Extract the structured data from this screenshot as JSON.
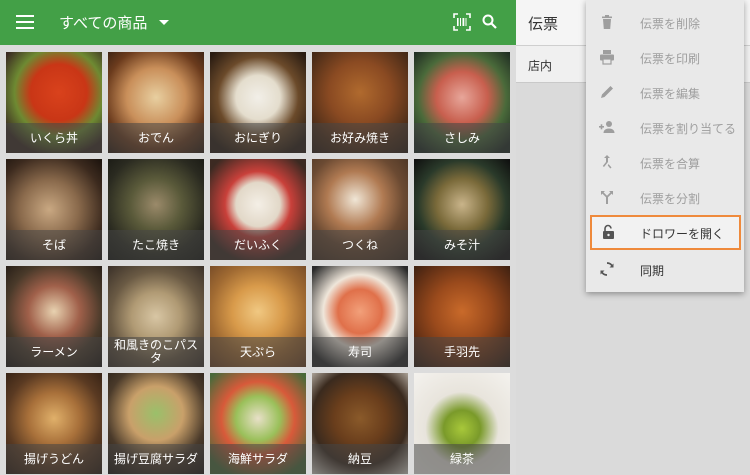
{
  "header": {
    "title": "すべての商品"
  },
  "products": [
    {
      "label": "いくら丼"
    },
    {
      "label": "おでん"
    },
    {
      "label": "おにぎり"
    },
    {
      "label": "お好み焼き"
    },
    {
      "label": "さしみ"
    },
    {
      "label": "そば"
    },
    {
      "label": "たこ焼き"
    },
    {
      "label": "だいふく"
    },
    {
      "label": "つくね"
    },
    {
      "label": "みそ汁"
    },
    {
      "label": "ラーメン"
    },
    {
      "label": "和風きのこパスタ"
    },
    {
      "label": "天ぷら"
    },
    {
      "label": "寿司"
    },
    {
      "label": "手羽先"
    },
    {
      "label": "揚げうどん"
    },
    {
      "label": "揚げ豆腐サラダ"
    },
    {
      "label": "海鮮サラダ"
    },
    {
      "label": "納豆"
    },
    {
      "label": "緑茶"
    }
  ],
  "slip_panel": {
    "title": "伝票",
    "row_label": "店内"
  },
  "menu": {
    "items": [
      {
        "label": "伝票を削除",
        "icon": "trash-icon"
      },
      {
        "label": "伝票を印刷",
        "icon": "printer-icon"
      },
      {
        "label": "伝票を編集",
        "icon": "pencil-icon"
      },
      {
        "label": "伝票を割り当てる",
        "icon": "assign-user-icon"
      },
      {
        "label": "伝票を合算",
        "icon": "merge-icon"
      },
      {
        "label": "伝票を分割",
        "icon": "split-icon"
      },
      {
        "label": "ドロワーを開く",
        "icon": "unlock-icon"
      },
      {
        "label": "同期",
        "icon": "sync-icon"
      }
    ]
  },
  "colors": {
    "toolbar": "#43a047",
    "highlight": "#ef8a3c"
  }
}
